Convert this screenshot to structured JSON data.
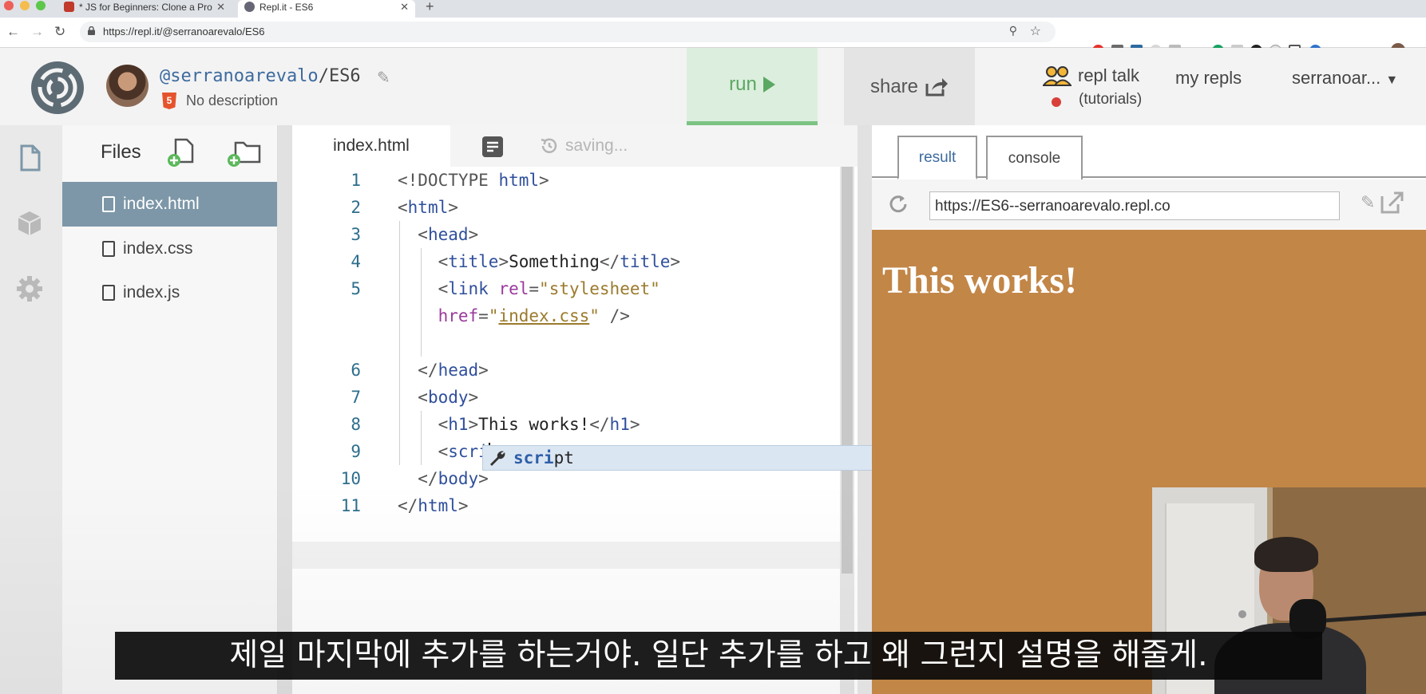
{
  "browser": {
    "tabs": [
      {
        "label": "* JS for Beginners: Clone a Pro",
        "active": false
      },
      {
        "label": "Repl.it - ES6",
        "active": true
      }
    ],
    "url": "https://repl.it/@serranoarevalo/ES6"
  },
  "repl": {
    "owner": "@serranoarevalo",
    "separator": "/",
    "name": "ES6",
    "description": "No description",
    "html_badge": "5",
    "run_label": "run",
    "share_label": "share",
    "talk_label": "repl talk",
    "talk_sub": "(tutorials)",
    "my_repls_label": "my repls",
    "username": "serranoar..."
  },
  "files": {
    "title": "Files",
    "items": [
      {
        "name": "index.html",
        "active": true
      },
      {
        "name": "index.css",
        "active": false
      },
      {
        "name": "index.js",
        "active": false
      }
    ]
  },
  "editor": {
    "tab_label": "index.html",
    "status": "saving...",
    "line_numbers": [
      "1",
      "2",
      "3",
      "4",
      "5",
      "6",
      "7",
      "8",
      "9",
      "10",
      "11"
    ],
    "autocomplete": {
      "match": "scri",
      "rest": "pt",
      "info": "i"
    }
  },
  "output": {
    "tabs": [
      "result",
      "console"
    ],
    "url": "https://ES6--serranoarevalo.repl.co",
    "heading": "This works!"
  },
  "subtitle": "제일 마지막에 추가를 하는거야. 일단 추가를 하고 왜 그런지 설명을 해줄게.",
  "colors": {
    "run_bg": "#dceedd",
    "run_accent": "#5aa863",
    "active_file_bg": "#7d97a8",
    "preview_bg": "#c28647",
    "owner_link": "#3d6b9e"
  }
}
